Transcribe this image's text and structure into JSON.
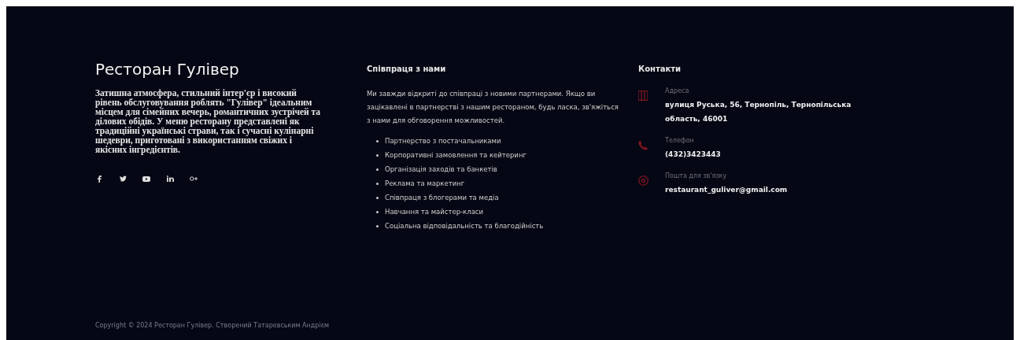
{
  "brand": {
    "title": "Ресторан Гулівер",
    "description": "Затишна атмосфера, стильний інтер'єр і високий рівень обслуговування роблять \"Гулівер\" ідеальним місцем для сімейних вечерь, романтичних зустрічей та ділових обідів. У меню ресторану представлені як традиційні українські страви, так і сучасні кулінарні шедеври, приготовані з використанням свіжих і якісних інгредієнтів.",
    "socials": [
      {
        "kind": "facebook"
      },
      {
        "kind": "twitter"
      },
      {
        "kind": "youtube"
      },
      {
        "kind": "linkedin"
      },
      {
        "kind": "google"
      }
    ]
  },
  "cooperation": {
    "heading": "Співпраця з нами",
    "intro": "Ми завжди відкриті до співпраці з новими партнерами. Якщо ви зацікавлені в партнерстві з нашим рестораном, будь ласка, зв'яжіться з нами для обговорення можливостей.",
    "items": [
      "Партнерство з постачальниками",
      "Корпоративні замовлення та кейтеринг",
      "Організація заходів та банкетів",
      "Реклама та маркетинг",
      "Співпраця з блогерами та медіа",
      "Навчання та майстер-класи",
      "Соціальна відповідальність та благодійність"
    ]
  },
  "contacts": {
    "heading": "Контакти",
    "items": [
      {
        "kind": "address",
        "label": "Адреса",
        "value": "вулиця Руська, 56, Тернопіль, Тернопільська область, 46001"
      },
      {
        "kind": "phone",
        "label": "Телефон",
        "value": "(432)3423443"
      },
      {
        "kind": "email",
        "label": "Пошта для зв'язку",
        "value": "restaurant_guliver@gmail.com"
      }
    ]
  },
  "copyright": "Copyright © 2024 Ресторан Гулівер. Створений Татаревським Андрієм"
}
